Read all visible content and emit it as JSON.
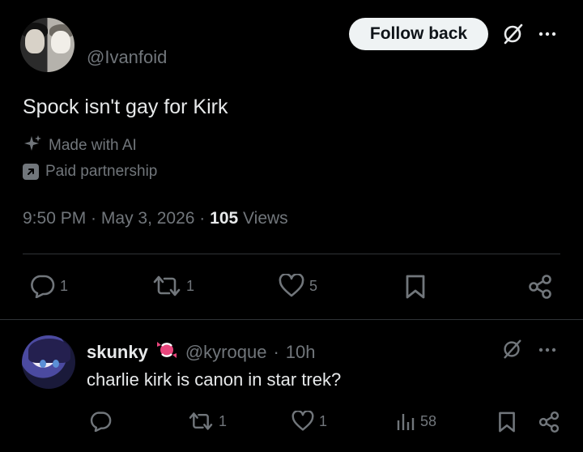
{
  "main_post": {
    "handle": "@Ivanfoid",
    "follow_label": "Follow back",
    "text": "Spock isn't gay for Kirk",
    "made_with_ai_label": "Made with AI",
    "paid_partnership_label": "Paid partnership",
    "time": "9:50 PM",
    "date": "May 3, 2026",
    "views_count": "105",
    "views_label": "Views",
    "actions": {
      "replies": "1",
      "reposts": "1",
      "likes": "5"
    }
  },
  "reply_post": {
    "display_name": "skunky",
    "handle": "@kyroque",
    "age": "10h",
    "text": "charlie kirk is canon in star trek?",
    "actions": {
      "replies": "",
      "reposts": "1",
      "likes": "1",
      "views": "58"
    }
  },
  "colors": {
    "background": "#000000",
    "primary_text": "#e7e9ea",
    "secondary_text": "#71767b",
    "divider": "#2f3336",
    "follow_button_bg": "#eff3f4",
    "badge_pink": "#e8457c"
  },
  "icons": {
    "grok": "grok-icon",
    "more": "more-icon",
    "sparkle": "sparkle-icon",
    "paid": "arrow-up-right-icon",
    "reply": "reply-icon",
    "repost": "repost-icon",
    "like": "heart-icon",
    "bookmark": "bookmark-icon",
    "share": "share-icon",
    "views": "views-icon",
    "badge": "candy-badge-icon"
  }
}
